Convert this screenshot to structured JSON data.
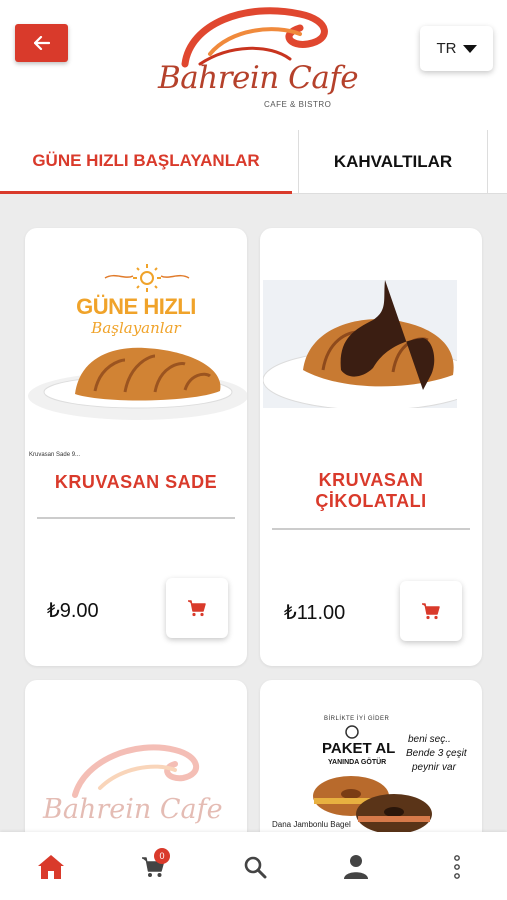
{
  "header": {
    "back_icon": "arrow-left-icon",
    "brand_title": "Bahrein Cafe",
    "brand_subtitle": "CAFE & BISTRO",
    "language": "TR",
    "accent_color": "#d93a2b"
  },
  "tabs": [
    {
      "label": "GÜNE HIZLI BAŞLAYANLAR",
      "active": true
    },
    {
      "label": "KAHVALTILAR",
      "active": false
    }
  ],
  "products": [
    {
      "name": "KRUVASAN SADE",
      "price": "₺9.00",
      "image_caption_1": "GÜNE HIZLI",
      "image_caption_2": "Başlayanlar",
      "image_footnote": "Kruvasan Sade 9..."
    },
    {
      "name_line1": "KRUVASAN",
      "name_line2": "ÇİKOLATALI",
      "price": "₺11.00"
    },
    {
      "brand_title": "Bahrein Cafe"
    },
    {
      "title": "PAKET AL",
      "subtitle": "YANINDA GÖTÜR",
      "top_text": "BİRLİKTE İYİ GİDER",
      "note_1": "beni seç..",
      "note_2": "Bende 3 çeşit",
      "note_3": "peynir var",
      "caption": "Dana Jambonlu Bagel"
    }
  ],
  "bottom_nav": {
    "items": [
      "home-icon",
      "cart-icon",
      "search-icon",
      "user-icon",
      "more-vertical-icon"
    ],
    "cart_count": "0"
  }
}
